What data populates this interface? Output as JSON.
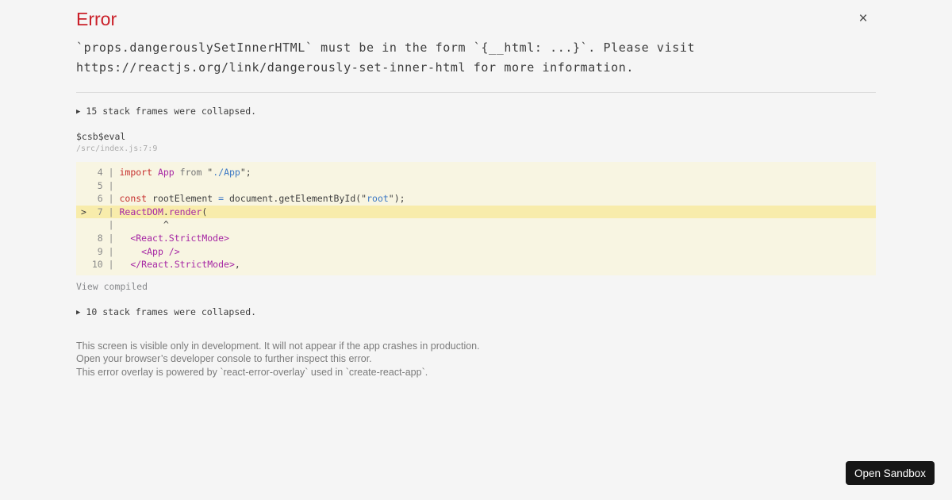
{
  "overlay": {
    "title": "Error",
    "message": "`props.dangerouslySetInnerHTML` must be in the form `{__html: ...}`. Please visit https://reactjs.org/link/dangerously-set-inner-html for more information."
  },
  "icons": {
    "close": "×",
    "collapsed_arrow": "▶"
  },
  "stack": {
    "collapsed_top": "15 stack frames were collapsed.",
    "frame_function": "$csb$eval",
    "frame_location": "/src/index.js:7:9",
    "view_compiled": "View compiled",
    "collapsed_bottom": "10 stack frames were collapsed."
  },
  "code_frame": {
    "lines": [
      {
        "highlight": false,
        "tokens": [
          [
            "   4 | ",
            "num"
          ],
          [
            "import",
            "kw"
          ],
          [
            " ",
            "pl"
          ],
          [
            "App",
            "id"
          ],
          [
            " ",
            "pl"
          ],
          [
            "from",
            "gr"
          ],
          [
            " \"",
            "pl"
          ],
          [
            "./App",
            "str"
          ],
          [
            "\";",
            "pl"
          ]
        ]
      },
      {
        "highlight": false,
        "tokens": [
          [
            "   5 | ",
            "num"
          ]
        ]
      },
      {
        "highlight": false,
        "tokens": [
          [
            "   6 | ",
            "num"
          ],
          [
            "const",
            "kw"
          ],
          [
            " ",
            "pl"
          ],
          [
            "rootElement",
            "pl"
          ],
          [
            " ",
            "pl"
          ],
          [
            "=",
            "op"
          ],
          [
            " document.getElementById(\"",
            "pl"
          ],
          [
            "root",
            "str"
          ],
          [
            "\");",
            "pl"
          ]
        ]
      },
      {
        "highlight": true,
        "tokens": [
          [
            "> ",
            "mark"
          ],
          [
            " 7 | ",
            "num"
          ],
          [
            "ReactDOM",
            "id"
          ],
          [
            ".",
            "pl"
          ],
          [
            "render",
            "id"
          ],
          [
            "(",
            "pl"
          ]
        ]
      },
      {
        "highlight": false,
        "tokens": [
          [
            "     | ",
            "num"
          ],
          [
            "        ^",
            "pl"
          ]
        ]
      },
      {
        "highlight": false,
        "tokens": [
          [
            "   8 | ",
            "num"
          ],
          [
            "  ",
            "pl"
          ],
          [
            "<React.StrictMode>",
            "id"
          ]
        ]
      },
      {
        "highlight": false,
        "tokens": [
          [
            "   9 | ",
            "num"
          ],
          [
            "    ",
            "pl"
          ],
          [
            "<App />",
            "id"
          ]
        ]
      },
      {
        "highlight": false,
        "tokens": [
          [
            "  10 | ",
            "num"
          ],
          [
            "  ",
            "pl"
          ],
          [
            "</React.StrictMode>",
            "id"
          ],
          [
            ",",
            "pl"
          ]
        ]
      }
    ]
  },
  "footer": {
    "line1": "This screen is visible only in development. It will not appear if the app crashes in production.",
    "line2": "Open your browser’s developer console to further inspect this error.",
    "line3": "This error overlay is powered by `react-error-overlay` used in `create-react-app`."
  },
  "actions": {
    "open_sandbox": "Open Sandbox"
  },
  "colors": {
    "background": "#f5f5f5",
    "error_title": "#ca2029",
    "body_text": "#3e3e3e",
    "code_background": "#f8f5e2",
    "code_highlight_row": "#f8ecab",
    "keyword": "#c62f2d",
    "identifier": "#a626a4",
    "string": "#3b78c4",
    "muted_gray": "#ababab",
    "button_background": "#161616",
    "button_text": "#ffffff"
  }
}
